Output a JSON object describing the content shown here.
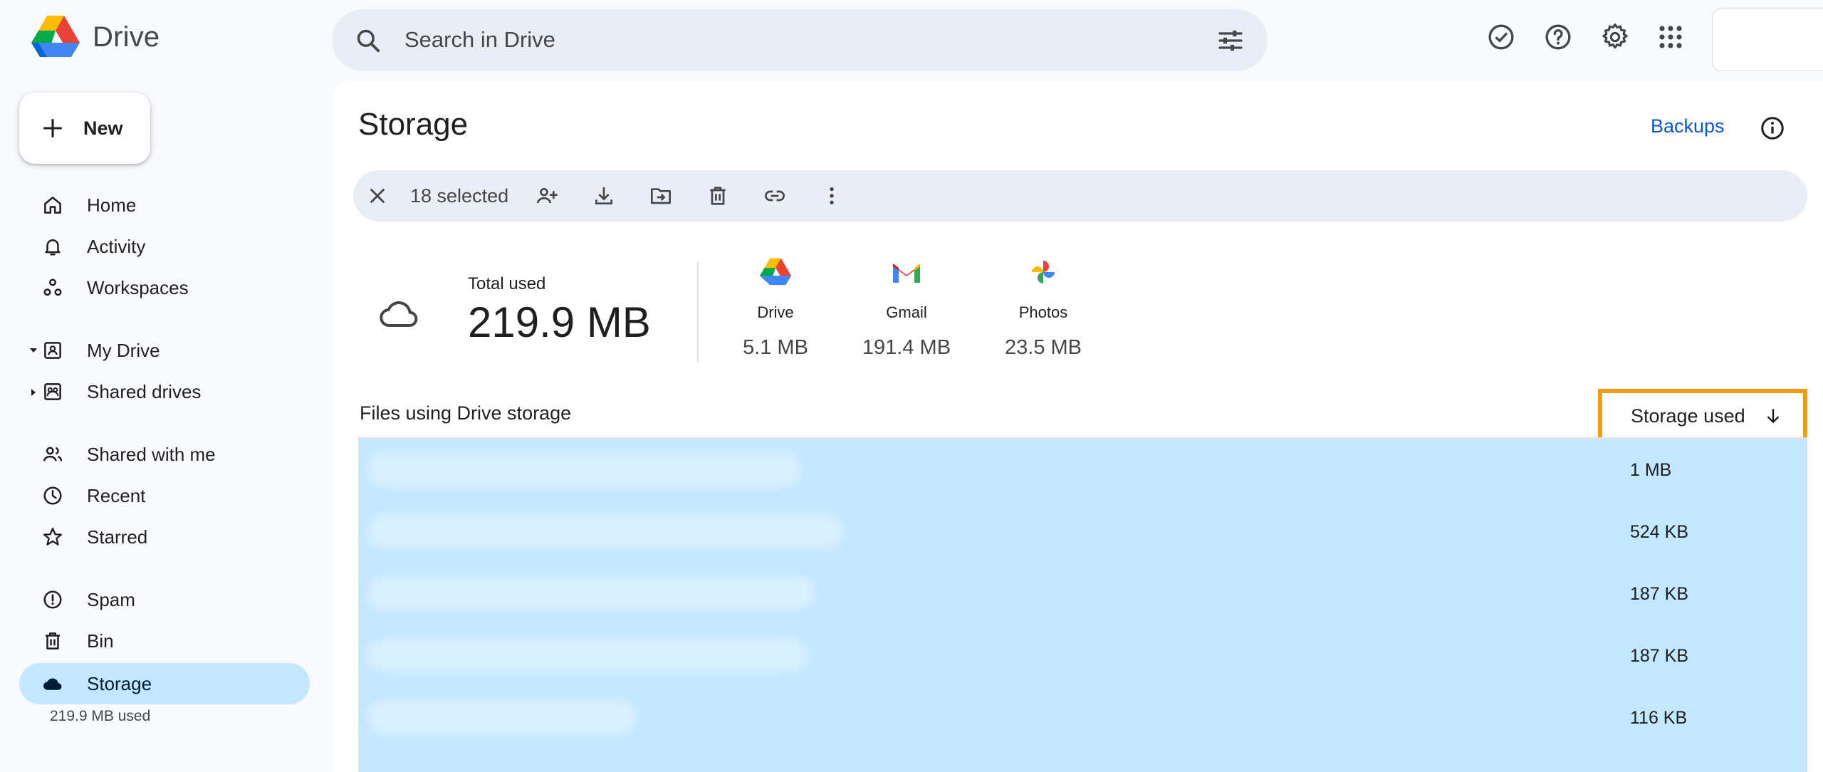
{
  "app": {
    "name": "Drive"
  },
  "search": {
    "placeholder": "Search in Drive"
  },
  "new_button": {
    "label": "New"
  },
  "sidebar": {
    "items": [
      {
        "label": "Home",
        "icon": "home-icon"
      },
      {
        "label": "Activity",
        "icon": "bell-icon"
      },
      {
        "label": "Workspaces",
        "icon": "workspaces-icon"
      },
      {
        "label": "My Drive",
        "icon": "my-drive-icon"
      },
      {
        "label": "Shared drives",
        "icon": "shared-drives-icon"
      },
      {
        "label": "Shared with me",
        "icon": "people-icon"
      },
      {
        "label": "Recent",
        "icon": "clock-icon"
      },
      {
        "label": "Starred",
        "icon": "star-icon"
      },
      {
        "label": "Spam",
        "icon": "spam-icon"
      },
      {
        "label": "Bin",
        "icon": "trash-icon"
      },
      {
        "label": "Storage",
        "icon": "cloud-icon",
        "active": true
      }
    ],
    "storage_used": "219.9 MB used"
  },
  "page": {
    "title": "Storage",
    "backups_label": "Backups"
  },
  "selection": {
    "text": "18 selected"
  },
  "summary": {
    "total_label": "Total used",
    "total_value": "219.9 MB",
    "services": [
      {
        "name": "Drive",
        "value": "5.1 MB"
      },
      {
        "name": "Gmail",
        "value": "191.4 MB"
      },
      {
        "name": "Photos",
        "value": "23.5 MB"
      }
    ]
  },
  "files": {
    "title": "Files using Drive storage",
    "sort_label": "Storage used",
    "rows": [
      {
        "size": "1 MB"
      },
      {
        "size": "524 KB"
      },
      {
        "size": "187 KB"
      },
      {
        "size": "187 KB"
      },
      {
        "size": "116 KB"
      }
    ]
  },
  "colors": {
    "accent": "#0b57d0",
    "selection": "#c2e7ff",
    "highlight_border": "#f29b0e"
  }
}
